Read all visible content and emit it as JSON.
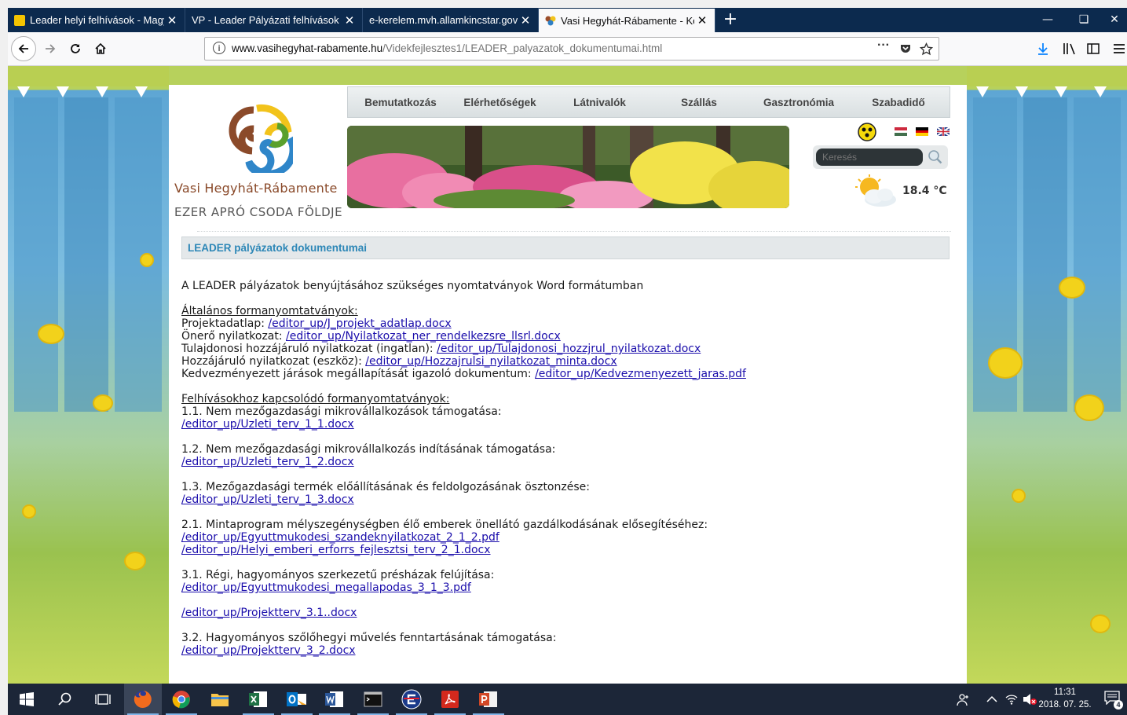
{
  "browser": {
    "tabs": [
      {
        "title": "Leader helyi felhívások - Magya",
        "active": false
      },
      {
        "title": "VP - Leader Pályázati felhívások bő",
        "active": false
      },
      {
        "title": "e-kerelem.mvh.allamkincstar.gov.h",
        "active": false
      },
      {
        "title": "Vasi Hegyhát-Rábamente - Kön",
        "active": true
      }
    ],
    "close_glyph": "✕",
    "new_tab_glyph": "+",
    "url_host": "www.vasihegyhat-rabamente.hu",
    "url_path": "/Videkfejlesztes1/LEADER_palyazatok_dokumentumai.html",
    "icons": [
      "back-icon",
      "forward-icon",
      "reload-icon",
      "home-icon",
      "info-icon",
      "more-icon",
      "pocket-icon",
      "star-icon",
      "download-icon",
      "library-icon",
      "sidebar-icon",
      "menu-icon"
    ]
  },
  "site": {
    "name": "Vasi Hegyhát-Rábamente",
    "tagline": "EZER APRÓ CSODA FÖLDJE",
    "menu": [
      "Bemutatkozás",
      "Elérhetőségek",
      "Látnivalók",
      "Szállás",
      "Gasztronómia",
      "Szabadidő"
    ],
    "search_placeholder": "Keresés",
    "temperature": "18.4 °C",
    "languages": [
      "hu",
      "de",
      "en"
    ]
  },
  "section_title": "LEADER pályázatok dokumentumai",
  "document": {
    "intro": "A LEADER pályázatok benyújtásához szükséges nyomtatványok Word formátumban",
    "general_heading": "Általános formanyomtatványok:",
    "general_items": [
      {
        "label": "Projektadatlap: ",
        "link": "/editor_up/J_projekt_adatlap.docx"
      },
      {
        "label": "Önerő nyilatkozat: ",
        "link": "/editor_up/Nyilatkozat_ner_rendelkezsre_llsrl.docx"
      },
      {
        "label": "Tulajdonosi hozzájáruló nyilatkozat (ingatlan): ",
        "link": "/editor_up/Tulajdonosi_hozzjrul_nyilatkozat.docx"
      },
      {
        "label": "Hozzájáruló nyilatkozat (eszköz): ",
        "link": "/editor_up/Hozzajrulsi_nyilatkozat_minta.docx"
      },
      {
        "label": "Kedvezményezett járások megállapítását igazoló dokumentum: ",
        "link": "/editor_up/Kedvezmenyezett_jaras.pdf"
      }
    ],
    "calls_heading": "Felhívásokhoz kapcsolódó formanyomtatványok:",
    "calls": [
      {
        "title": "1.1. Nem mezőgazdasági mikrovállalkozások támogatása:",
        "links": [
          "/editor_up/Uzleti_terv_1_1.docx"
        ]
      },
      {
        "title": "1.2. Nem mezőgazdasági mikrovállalkozás indításának támogatása:",
        "links": [
          "/editor_up/Uzleti_terv_1_2.docx"
        ]
      },
      {
        "title": "1.3. Mezőgazdasági termék előállításának és feldolgozásának ösztonzése:",
        "links": [
          "/editor_up/Uzleti_terv_1_3.docx"
        ]
      },
      {
        "title": "2.1. Mintaprogram mélyszegénységben élő emberek önellátó gazdálkodásának elősegítéséhez:",
        "links": [
          "/editor_up/Egyuttmukodesi_szandeknyilatkozat_2_1_2.pdf",
          "/editor_up/Helyi_emberi_erforrs_fejlesztsi_terv_2_1.docx"
        ]
      },
      {
        "title": "3.1. Régi, hagyományos szerkezetű présházak felújítása:",
        "links": [
          "/editor_up/Egyuttmukodesi_megallapodas_3_1_3.pdf"
        ]
      },
      {
        "title": "",
        "links": [
          "/editor_up/Projektterv_3.1..docx"
        ]
      },
      {
        "title": "3.2. Hagyományos szőlőhegyi művelés fenntartásának támogatása:",
        "links": [
          "/editor_up/Projektterv_3_2.docx"
        ]
      }
    ]
  },
  "taskbar": {
    "apps": [
      "windows-start",
      "search",
      "task-view",
      "firefox",
      "chrome",
      "file-explorer",
      "excel",
      "outlook",
      "word",
      "command-prompt",
      "e-app",
      "acrobat",
      "powerpoint"
    ],
    "time": "11:31",
    "date": "2018. 07. 25.",
    "notification_count": "4"
  },
  "colors": {
    "tab_bg": "#0c2a4e",
    "link": "#1a0dab",
    "section_title": "#2d87b7",
    "taskbar": "#1c2638"
  }
}
